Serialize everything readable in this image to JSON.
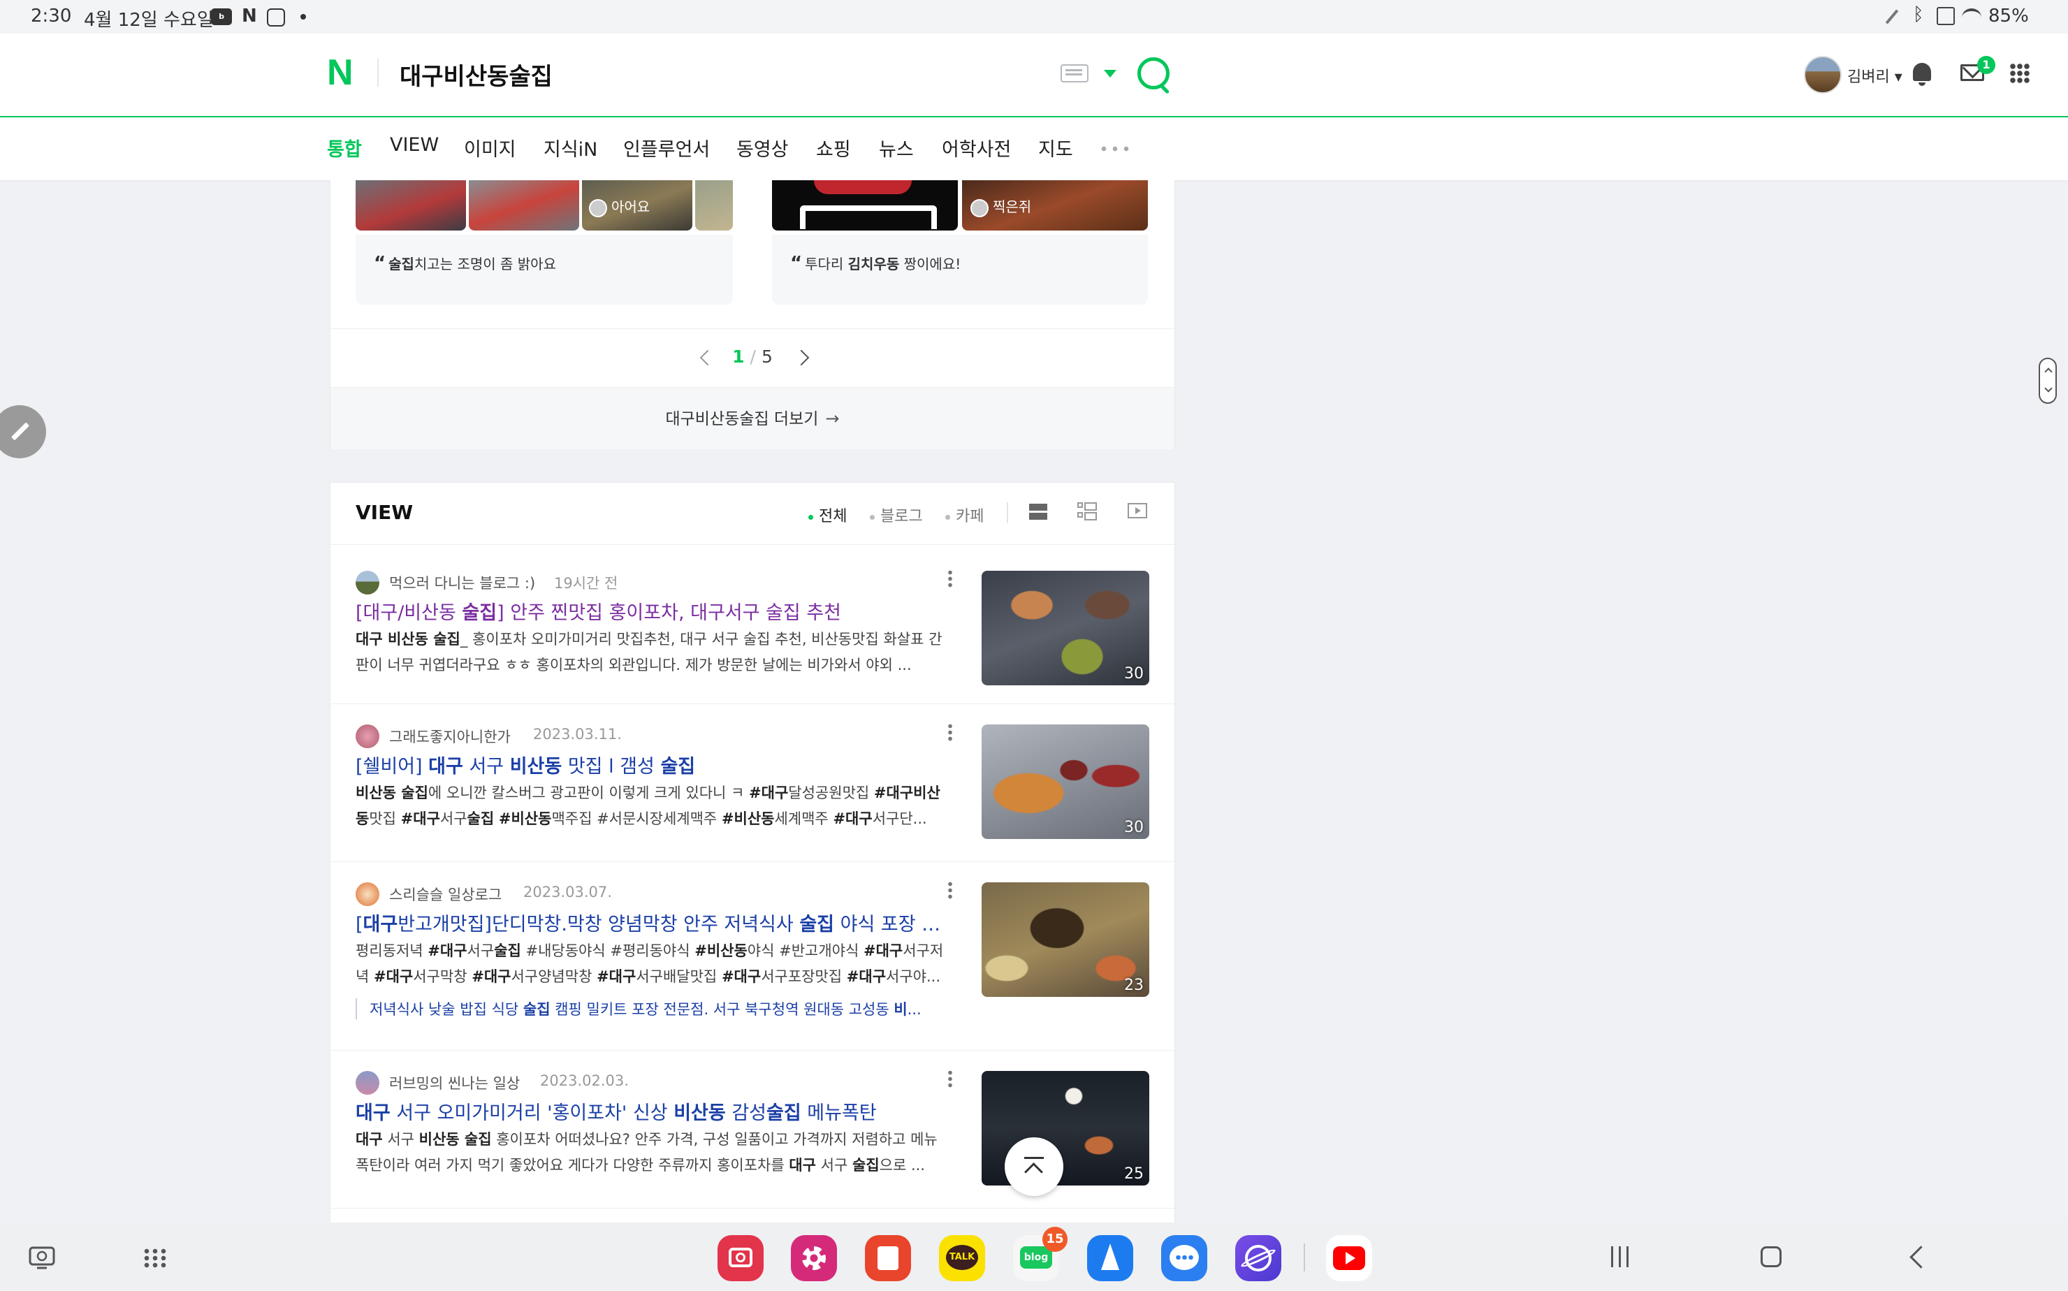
{
  "status_bar": {
    "time": "2:30",
    "date": "4월 12일 수요일",
    "notification_icons": [
      "blog-icon",
      "netflix-icon",
      "instagram-icon",
      "dot-icon"
    ],
    "battery": "85%",
    "system_icons": [
      "pen-icon",
      "bluetooth-icon",
      "mute-icon",
      "wifi-icon"
    ]
  },
  "header": {
    "logo": "N",
    "query": "대구비산동술집",
    "username": "김벼리",
    "mail_badge": "1"
  },
  "nav_tabs": [
    {
      "label": "통합",
      "active": true
    },
    {
      "label": "VIEW"
    },
    {
      "label": "이미지"
    },
    {
      "label": "지식iN"
    },
    {
      "label": "인플루언서"
    },
    {
      "label": "동영상"
    },
    {
      "label": "쇼핑"
    },
    {
      "label": "뉴스"
    },
    {
      "label": "어학사전"
    },
    {
      "label": "지도"
    }
  ],
  "place_reviews": {
    "left": {
      "reviewer": "아어요",
      "quote_keyword": "술집",
      "quote_rest": "치고는 조명이 좀 밝아요"
    },
    "right": {
      "reviewer": "찍은쥐",
      "quote_prefix": "투다리 ",
      "quote_keyword": "김치우동",
      "quote_rest": " 짱이에요!"
    },
    "pager": {
      "current": "1",
      "separator": "/",
      "total": "5"
    },
    "more_link": "대구비산동술집 더보기"
  },
  "view_section": {
    "title": "VIEW",
    "filters": [
      {
        "label": "전체",
        "active": true
      },
      {
        "label": "블로그"
      },
      {
        "label": "카페"
      }
    ],
    "posts": [
      {
        "author": "먹으러 다니는 블로그 :)",
        "date": "19시간 전",
        "title_html": "[대구/비산동 <b>술집</b>] 안주 찐맛집 홍이포차, 대구서구 술집 추천",
        "visited": true,
        "desc_html": "<b>대구 비산동 술집</b>_ 홍이포차 오미가미거리 맛집추천, 대구 서구 술집 추천, 비산동맛집 화살표 간판이 너무 귀엽더라구요 ㅎㅎ 홍이포차의 외관입니다. 제가 방문한 날에는 비가와서 야외 ...",
        "image_count": "30"
      },
      {
        "author": "그래도좋지아니한가",
        "date": "2023.03.11.",
        "title_html": "[쉘비어] <b>대구</b> 서구 <b>비산동</b> 맛집 l 갬성 <b>술집</b>",
        "visited": false,
        "desc_html": "<b>비산동 술집</b>에 오니깐 칼스버그 광고판이 이렇게 크게 있다니 ㅋ <b>#대구</b>달성공원맛집 <b>#대구비산동</b>맛집 <b>#대구</b>서구<b>술집</b> <b>#비산동</b>맥주집 #서문시장세계맥주 <b>#비산동</b>세계맥주 <b>#대구</b>서구단...",
        "image_count": "30"
      },
      {
        "author": "스리슬슬 일상로그",
        "date": "2023.03.07.",
        "title_html": "[<b>대구</b>반고개맛집]단디막창.막창 양념막창 안주 저녁식사 <b>술집</b> 야식 포장 배...",
        "visited": false,
        "desc_html": "평리동저녁 <b>#대구</b>서구<b>술집</b> #내당동야식 #평리동야식 <b>#비산동</b>야식 #반고개야식 <b>#대구</b>서구저녁 <b>#대구</b>서구막창 <b>#대구</b>서구양념막창 <b>#대구</b>서구배달맛집 <b>#대구</b>서구포장맛집 <b>#대구</b>서구야...",
        "link_html": "저녁식사 낮술 밥집 식당 <b>술집</b> 캠핑 밀키트 포장 전문점. 서구 북구청역 원대동 고성동 <b>비</b>...",
        "image_count": "23"
      },
      {
        "author": "러브밍의 씬나는 일상",
        "date": "2023.02.03.",
        "title_html": "<b>대구</b> 서구 오미가미거리 '홍이포차' 신상 <b>비산동</b> 감성<b>술집</b> 메뉴폭탄",
        "visited": false,
        "desc_html": "<b>대구</b> 서구 <b>비산동 술집</b> 홍이포차 어떠셨나요? 안주 가격, 구성 일품이고 가격까지 저렴하고 메뉴폭탄이라 여러 가지 먹기 좋았어요 게다가 다양한 주류까지 홍이포차를 <b>대구</b> 서구 <b>술집</b>으로 ...",
        "image_count": "25"
      }
    ]
  },
  "dock": {
    "apps": [
      "camera-app-icon",
      "gallery-app-icon",
      "notes-app-icon",
      "kakaotalk-app-icon",
      "blog-app-icon",
      "navigation-app-icon",
      "messages-app-icon",
      "internet-app-icon",
      "youtube-app-icon"
    ],
    "kakaotalk_label": "TALK",
    "blog_label": "blog",
    "blog_badge": "15"
  },
  "colors": {
    "brand_green": "#03c75a",
    "link_blue": "#1a3fa6",
    "visited_purple": "#7b2ea0"
  }
}
